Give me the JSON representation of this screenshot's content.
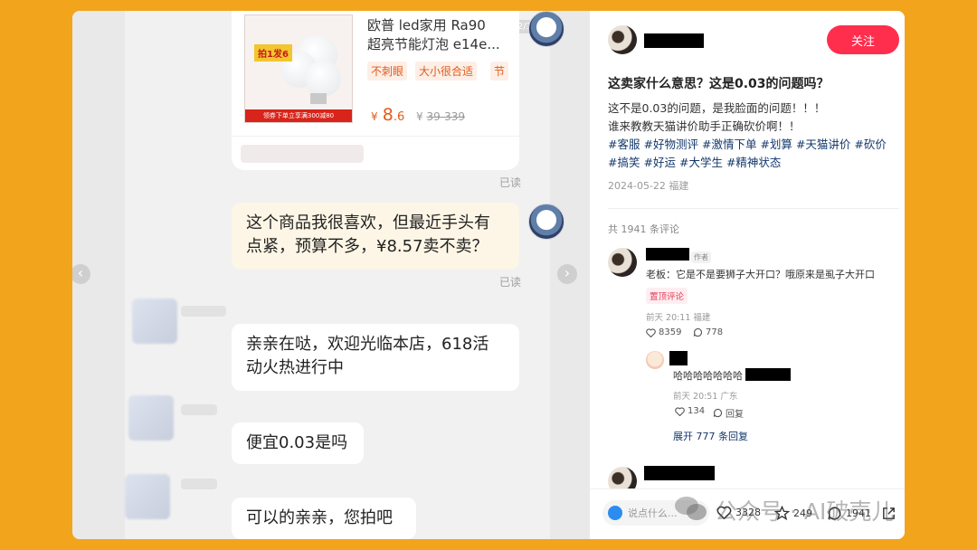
{
  "left_chat": {
    "page_indicator": "2/3",
    "product": {
      "title_line1": "欧普 led家用 Ra90",
      "title_line2": "超亮节能灯泡 e14e...",
      "tags": [
        "不刺眼",
        "大小很合适",
        "节"
      ],
      "price_currency": "¥",
      "price_int": "8",
      "price_dec": ".6",
      "orig_currency": "¥",
      "orig_range": "39-339",
      "img_tag": "拍1发6",
      "img_footer": "领券下单立享满300减80"
    },
    "read_label": "已读",
    "messages": [
      {
        "from": "me",
        "text": "这个商品我很喜欢，但最近手头有点紧，预算不多，¥8.57卖不卖？"
      },
      {
        "from": "them",
        "text": "亲亲在哒，欢迎光临本店，618活动火热进行中"
      },
      {
        "from": "them",
        "text": "便宜0.03是吗"
      },
      {
        "from": "them",
        "text": "可以的亲亲，您拍吧"
      }
    ]
  },
  "post": {
    "follow_label": "关注",
    "title": "这卖家什么意思？这是0.03的问题吗？",
    "body_line1": "这不是0.03的问题，是我脸面的问题！！！",
    "body_line2": "谁来教教天猫讲价助手正确砍价啊！！",
    "tags": [
      "#客服",
      "#好物测评",
      "#激情下单",
      "#划算",
      "#天猫讲价",
      "#砍价",
      "#搞笑",
      "#好运",
      "#大学生",
      "#精神状态"
    ],
    "date": "2024-05-22 福建",
    "comment_count": "共 1941 条评论"
  },
  "comment": {
    "author_badge": "作者",
    "text": "老板：它是不是要狮子大开口？哦原来是虱子大开口",
    "pin_label": "置顶评论",
    "meta": "前天 20:11 福建",
    "likes": "8359",
    "replies": "778",
    "reply": {
      "text": "哈哈哈哈哈哈哈",
      "meta": "前天 20:51 广东",
      "likes": "134",
      "reply_label": "回复"
    },
    "expand_label": "展开 777 条回复"
  },
  "bottom_bar": {
    "input_placeholder": "说点什么...",
    "likes": "3328",
    "stars": "249",
    "comments": "1941"
  },
  "watermark": {
    "text": "公众号 · AI破壳儿"
  },
  "colors": {
    "background": "#f3a41d",
    "follow_button": "#ff2e4d",
    "tag_link": "#13386c",
    "price": "#e45b1a"
  }
}
